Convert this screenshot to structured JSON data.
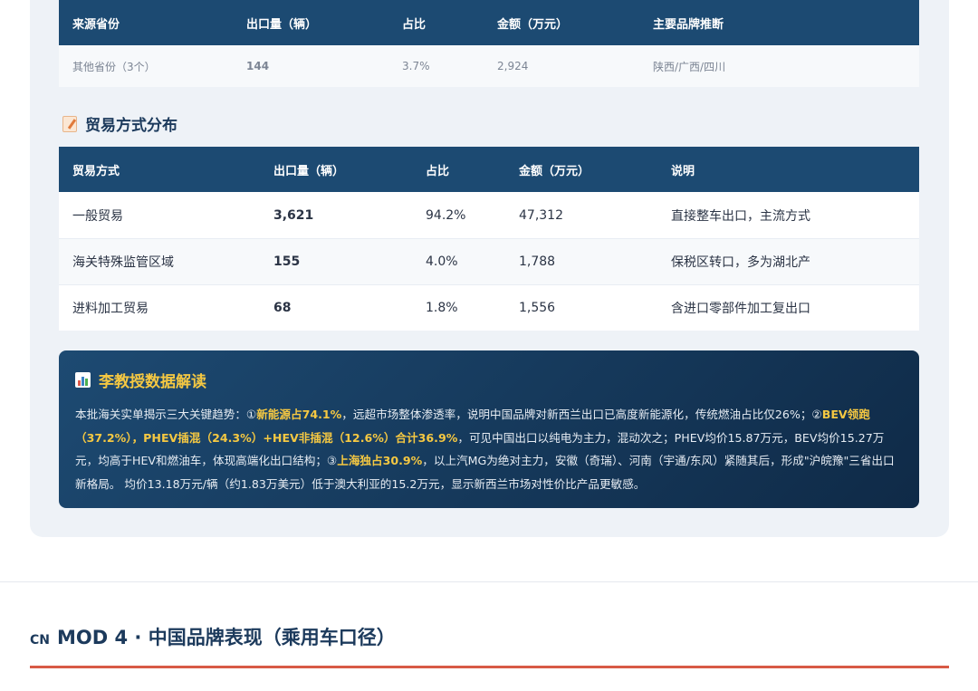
{
  "province_table": {
    "headers": [
      "来源省份",
      "出口量（辆）",
      "占比",
      "金额（万元）",
      "主要品牌推断"
    ],
    "rows": [
      [
        "其他省份（3个）",
        "144",
        "3.7%",
        "2,924",
        "陕西/广西/四川"
      ]
    ]
  },
  "trade_section": {
    "title": "贸易方式分布",
    "icon": "memo-icon"
  },
  "trade_table": {
    "headers": [
      "贸易方式",
      "出口量（辆）",
      "占比",
      "金额（万元）",
      "说明"
    ],
    "rows": [
      [
        "一般贸易",
        "3,621",
        "94.2%",
        "47,312",
        "直接整车出口，主流方式"
      ],
      [
        "海关特殊监管区域",
        "155",
        "4.0%",
        "1,788",
        "保税区转口，多为湖北产"
      ],
      [
        "进料加工贸易",
        "68",
        "1.8%",
        "1,556",
        "含进口零部件加工复出口"
      ]
    ]
  },
  "insight": {
    "title": "李教授数据解读",
    "icon": "bar-chart-icon",
    "p1": "本批海关实单揭示三大关键趋势：①",
    "h1": "新能源占74.1%",
    "p2": "，远超市场整体渗透率，说明中国品牌对新西兰出口已高度新能源化，传统燃油占比仅26%；②",
    "h2": "BEV领跑（37.2%），PHEV插混（24.3%）+HEV非插混（12.6%）合计36.9%",
    "p3": "，可见中国出口以纯电为主力，混动次之；PHEV均价15.87万元，BEV均价15.27万元，均高于HEV和燃油车，体现高端化出口结构；③",
    "h3": "上海独占30.9%",
    "p4": "，以上汽MG为绝对主力，安徽（奇瑞）、河南（宇通/东风）紧随其后，形成\"沪皖豫\"三省出口新格局。 均价13.18万元/辆（约1.83万美元）低于澳大利亚的15.2万元，显示新西兰市场对性价比产品更敏感。"
  },
  "module": {
    "flag": "CN",
    "title": "MOD 4 · 中国品牌表现（乘用车口径）"
  },
  "colors": {
    "header_bg": "#1c4a72",
    "highlight": "#f5c842",
    "accent_red": "#d85a45"
  }
}
